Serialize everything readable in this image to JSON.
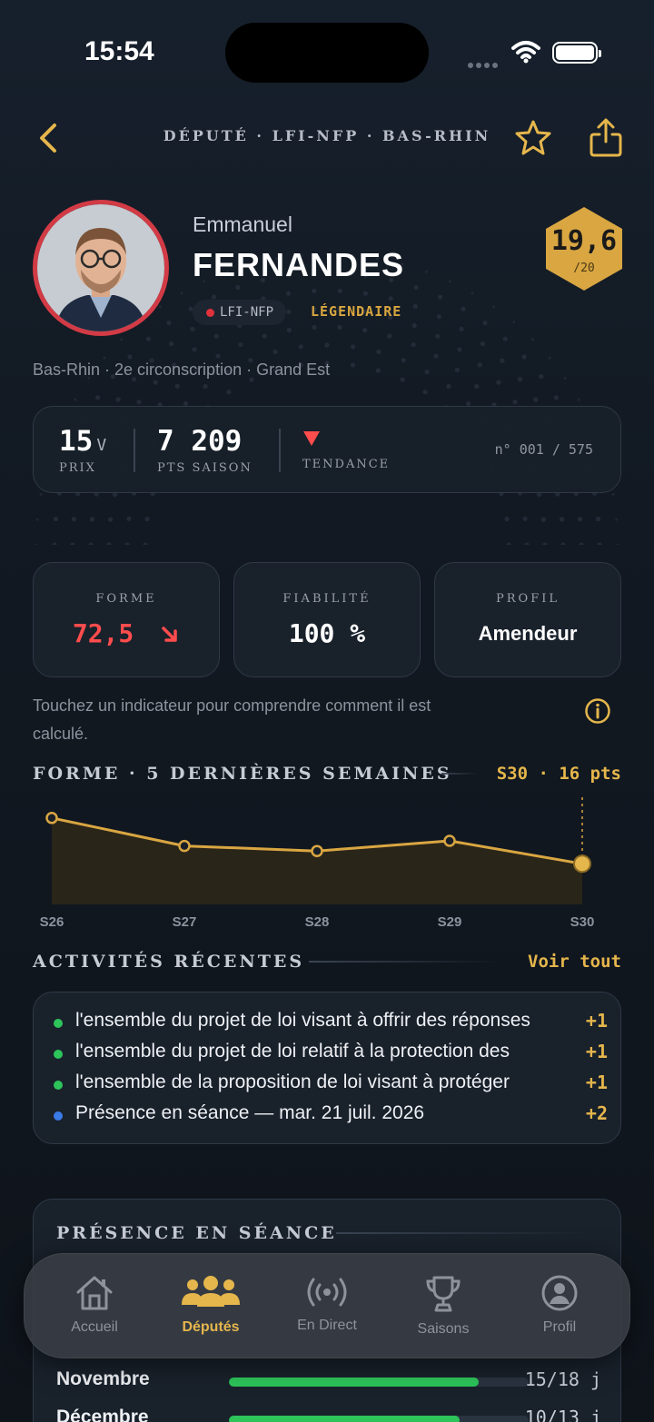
{
  "status_bar": {
    "time": "15:54"
  },
  "nav": {
    "title": "DÉPUTÉ · LFI-NFP · BAS-RHIN"
  },
  "profile": {
    "first_name": "Emmanuel",
    "last_name": "FERNANDES",
    "party": "LFI-NFP",
    "rarity": "LÉGENDAIRE",
    "rating": "19,6",
    "rating_scale": "/20",
    "location": "Bas-Rhin · 2e circonscription · Grand Est"
  },
  "stats": {
    "price_value": "15",
    "price_unit": "V",
    "price_label": "PRIX",
    "points_value": "7 209",
    "points_label": "PTS SAISON",
    "trend_label": "TENDANCE",
    "trend_direction": "down",
    "rank": "n° 001 / 575"
  },
  "indicators": [
    {
      "label": "FORME",
      "value": "72,5"
    },
    {
      "label": "FIABILITÉ",
      "value": "100 %"
    },
    {
      "label": "PROFIL",
      "value": "Amendeur"
    }
  ],
  "hint": "Touchez un indicateur pour comprendre comment il est calculé.",
  "form_section": {
    "title": "FORME · 5 DERNIÈRES SEMAINES",
    "latest": "S30 · 16 pts"
  },
  "chart_data": {
    "type": "area",
    "categories": [
      "S26",
      "S27",
      "S28",
      "S29",
      "S30"
    ],
    "values": [
      34,
      23,
      21,
      25,
      16
    ],
    "ylim": [
      0,
      40
    ],
    "highlight": "S30",
    "color": "#d9a642"
  },
  "activities": {
    "title": "ACTIVITÉS RÉCENTES",
    "see_all": "Voir tout",
    "items": [
      {
        "text": "l'ensemble du projet de loi visant à offrir des réponses",
        "points": "+1",
        "color": "#2dc45a"
      },
      {
        "text": "l'ensemble du projet de loi relatif à la protection des",
        "points": "+1",
        "color": "#2dc45a"
      },
      {
        "text": "l'ensemble de la proposition de loi visant à protéger",
        "points": "+1",
        "color": "#2dc45a"
      },
      {
        "text": "Présence en séance — mar. 21 juil. 2026",
        "points": "+2",
        "color": "#3b7be8"
      }
    ]
  },
  "presence": {
    "title": "PRÉSENCE EN SÉANCE",
    "rows": [
      {
        "month": "Novembre",
        "count": "15/18 j",
        "ratio": 0.833
      },
      {
        "month": "Décembre",
        "count": "10/13 j",
        "ratio": 0.769
      }
    ]
  },
  "tabs": [
    {
      "label": "Accueil",
      "icon": "home-icon"
    },
    {
      "label": "Députés",
      "icon": "people-icon"
    },
    {
      "label": "En Direct",
      "icon": "broadcast-icon"
    },
    {
      "label": "Saisons",
      "icon": "trophy-icon"
    },
    {
      "label": "Profil",
      "icon": "profile-icon"
    }
  ],
  "colors": {
    "accent": "#e5b64c",
    "danger": "#ff4c4c",
    "party": "#e0323c",
    "background": "#11151c"
  }
}
